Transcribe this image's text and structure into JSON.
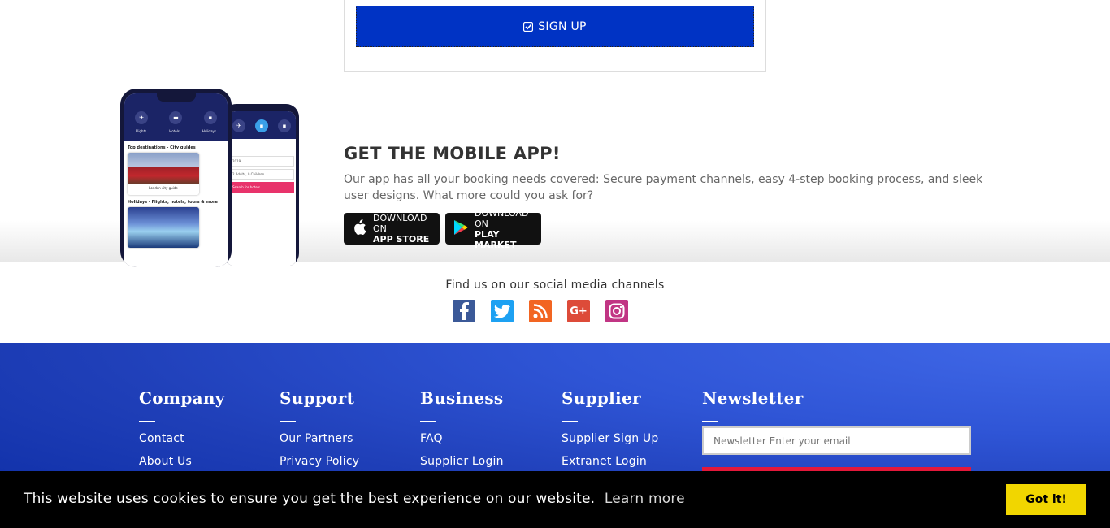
{
  "signup": {
    "button_label": "SIGN UP"
  },
  "mobile_app": {
    "title": "GET THE MOBILE APP!",
    "description": "Our app has all your booking needs covered: Secure payment channels, easy 4-step booking process, and sleek user designs. What more could you ask for?",
    "app_store": {
      "small": "DOWNLOAD ON",
      "big": "APP STORE"
    },
    "play_market": {
      "small": "DOWNLOAD ON",
      "big": "PLAY MARKET"
    },
    "phone": {
      "tabs": [
        "Flights",
        "Hotels",
        "Holidays"
      ],
      "section1": "Top destinations - City guides",
      "card1": "London city guide",
      "section2": "Holidays - Flights, hotels, tours & more",
      "back_rows": [
        "2019",
        "2 Adults, 0 Children"
      ],
      "back_search": "Search for hotels"
    }
  },
  "social": {
    "label": "Find us on our social media channels",
    "icons": [
      "facebook-icon",
      "twitter-icon",
      "rss-icon",
      "google-plus-icon",
      "instagram-icon"
    ],
    "colors": {
      "facebook": "#3b5998",
      "twitter": "#1da1f2",
      "rss": "#f26522",
      "google_plus": "#dd4b39",
      "instagram": "#c13584"
    }
  },
  "footer": {
    "columns": [
      {
        "title": "Company",
        "links": [
          "Contact",
          "About Us"
        ]
      },
      {
        "title": "Support",
        "links": [
          "Our Partners",
          "Privacy Policy"
        ]
      },
      {
        "title": "Business",
        "links": [
          "FAQ",
          "Supplier Login"
        ]
      },
      {
        "title": "Supplier",
        "links": [
          "Supplier Sign Up",
          "Extranet Login"
        ]
      }
    ],
    "newsletter": {
      "title": "Newsletter",
      "placeholder": "Newsletter Enter your email"
    }
  },
  "cookie": {
    "message": "This website uses cookies to ensure you get the best experience on our website.",
    "learn_more": "Learn more",
    "accept": "Got it!"
  },
  "colors": {
    "primary": "#0033c4",
    "accent_red": "#e4183a",
    "cookie_button": "#f1d600"
  }
}
